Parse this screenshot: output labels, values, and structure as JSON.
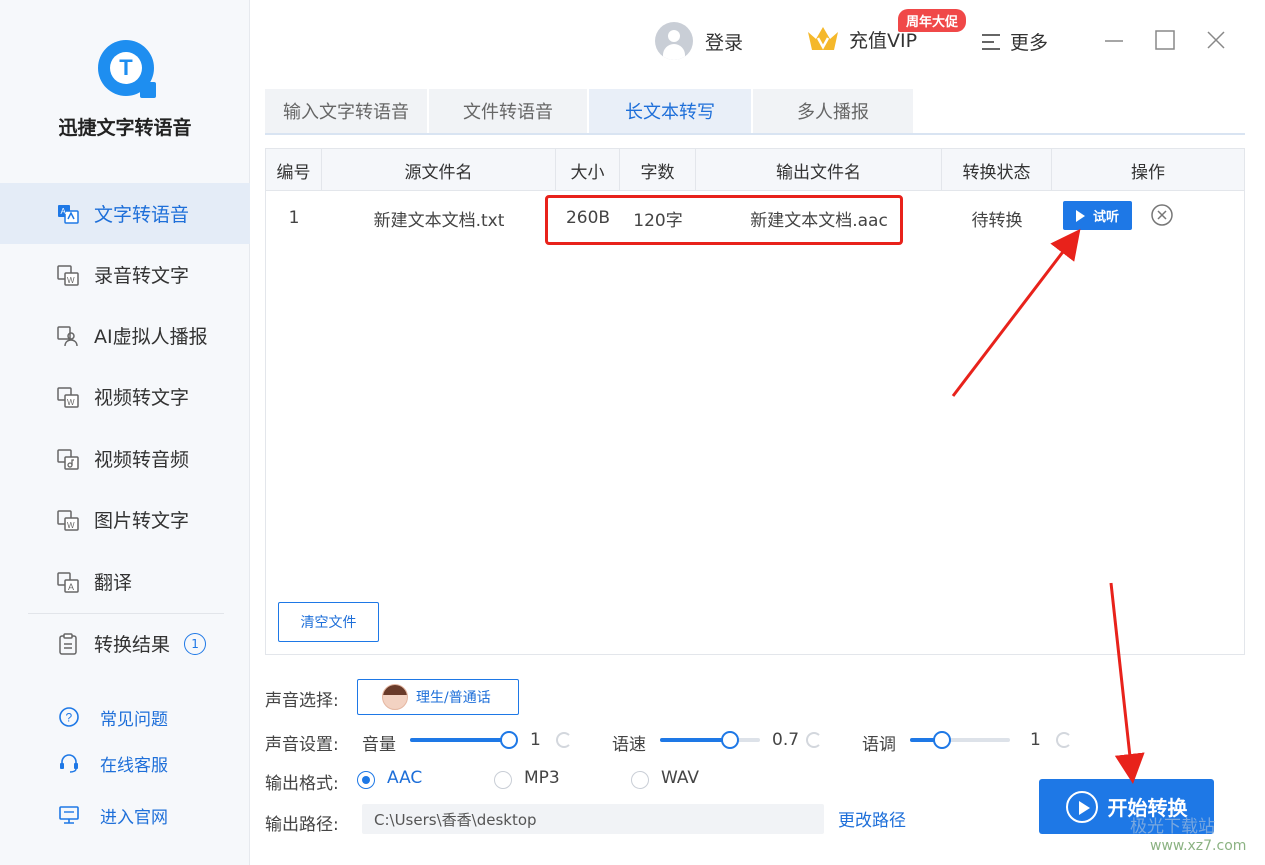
{
  "app": {
    "name": "迅捷文字转语音",
    "logo_letter": "T"
  },
  "sidebar": {
    "items": [
      {
        "label": "文字转语音",
        "icon": "text-to-speech-icon",
        "active": true
      },
      {
        "label": "录音转文字",
        "icon": "recording-to-text-icon"
      },
      {
        "label": "AI虚拟人播报",
        "icon": "ai-avatar-icon"
      },
      {
        "label": "视频转文字",
        "icon": "video-to-text-icon"
      },
      {
        "label": "视频转音频",
        "icon": "video-to-audio-icon"
      },
      {
        "label": "图片转文字",
        "icon": "image-to-text-icon"
      },
      {
        "label": "翻译",
        "icon": "translate-icon"
      },
      {
        "label": "转换结果",
        "icon": "results-icon",
        "badge": "1"
      }
    ],
    "bottom": [
      {
        "label": "常见问题",
        "icon": "help-icon"
      },
      {
        "label": "在线客服",
        "icon": "headset-icon"
      },
      {
        "label": "进入官网",
        "icon": "monitor-icon"
      }
    ]
  },
  "topbar": {
    "login": "登录",
    "vip": "充值VIP",
    "promo": "周年大促",
    "more": "更多"
  },
  "tabs": [
    {
      "label": "输入文字转语音"
    },
    {
      "label": "文件转语音"
    },
    {
      "label": "长文本转写",
      "active": true
    },
    {
      "label": "多人播报"
    }
  ],
  "table": {
    "columns": [
      "编号",
      "源文件名",
      "大小",
      "字数",
      "输出文件名",
      "转换状态",
      "操作"
    ],
    "rows": [
      {
        "index": "1",
        "source": "新建文本文档.txt",
        "size": "260B",
        "chars": "120字",
        "output": "新建文本文档.aac",
        "status": "待转换",
        "listen": "试听"
      }
    ],
    "clear_button": "清空文件"
  },
  "settings": {
    "voice_label": "声音选择:",
    "voice_value": "理生/普通话",
    "sound_label": "声音设置:",
    "volume_label": "音量",
    "volume_value": "1",
    "speed_label": "语速",
    "speed_value": "0.7",
    "pitch_label": "语调",
    "pitch_value": "1",
    "format_label": "输出格式:",
    "formats": [
      "AAC",
      "MP3",
      "WAV"
    ],
    "selected_format": "AAC",
    "path_label": "输出路径:",
    "path_value": "C:\\Users\\香香\\desktop",
    "change_path": "更改路径",
    "start_button": "开始转换"
  },
  "watermark": {
    "line1": "极光下载站",
    "line2": "www.xz7.com"
  },
  "colors": {
    "accent": "#1e78e6",
    "highlight_red": "#e8221b",
    "promo_red": "#f04848"
  }
}
